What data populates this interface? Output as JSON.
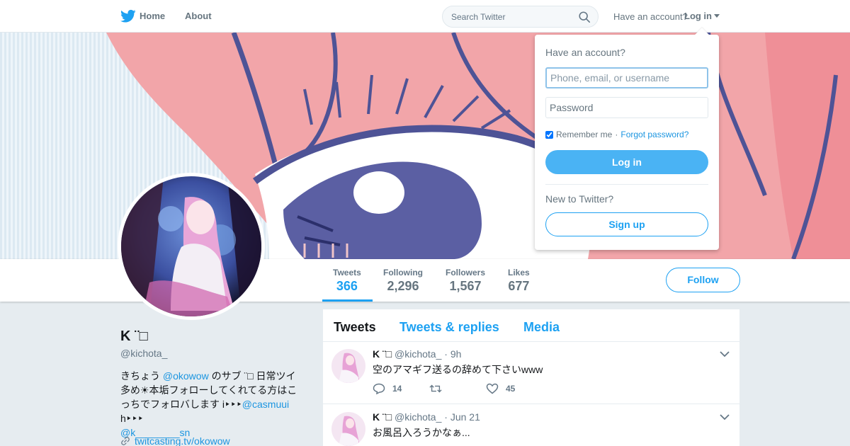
{
  "nav": {
    "home_label": "Home",
    "about_label": "About",
    "search_placeholder": "Search Twitter",
    "have_account": "Have an account?",
    "login_label": "Log in"
  },
  "profile": {
    "name": "K ¨□",
    "handle": "@kichota_",
    "bio_parts": {
      "p1": "きちょう ",
      "link1": "@okowow",
      "p2": " のサブ ¨□ 日常ツイ多め☀本垢フォローしてくれてる方はこっちでフォロバします i‣‣‣",
      "link2": "@casmuui",
      "p3": " h‣‣‣",
      "link3": "@k________sn"
    },
    "url": "twitcasting.tv/okowow"
  },
  "stats": [
    {
      "label": "Tweets",
      "value": "366"
    },
    {
      "label": "Following",
      "value": "2,296"
    },
    {
      "label": "Followers",
      "value": "1,567"
    },
    {
      "label": "Likes",
      "value": "677"
    }
  ],
  "follow_label": "Follow",
  "timeline": {
    "tabs": [
      "Tweets",
      "Tweets & replies",
      "Media"
    ],
    "tweets": [
      {
        "name": "K ¨□",
        "handle": "@kichota_",
        "time": "· 9h",
        "text": "空のアマギフ送るの辞めて下さいwww",
        "replies": "14",
        "retweets": "",
        "likes": "45"
      },
      {
        "name": "K ¨□",
        "handle": "@kichota_",
        "time": "· Jun 21",
        "text": "お風呂入ろうかなぁ..."
      }
    ]
  },
  "login_dropdown": {
    "title": "Have an account?",
    "username_placeholder": "Phone, email, or username",
    "password_placeholder": "Password",
    "remember_label": "Remember me",
    "separator": "·",
    "forgot_label": "Forgot password?",
    "login_button": "Log in",
    "new_label": "New to Twitter?",
    "signup_button": "Sign up"
  },
  "colors": {
    "accent": "#1da1f2",
    "login_button_bg": "#4ab3f4",
    "link": "#1b95e0"
  }
}
